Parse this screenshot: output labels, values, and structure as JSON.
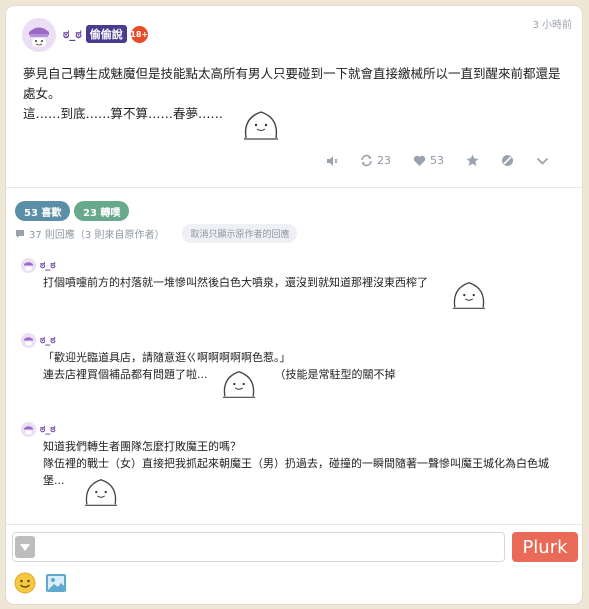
{
  "post": {
    "nickname": "ಠ_ಠ",
    "qualifier": "偷偷說",
    "age_badge": "18+",
    "time": "3 小時前",
    "line1": "夢見自己轉生成魅魔但是技能點太高所有男人只要碰到一下就會直接繳械所以一直到醒來前都還是處女。",
    "line2": "這……到底……算不算……春夢……"
  },
  "actions": {
    "mute_icon": "mute-icon",
    "replurk_count": "23",
    "like_count": "53",
    "favorite_icon": "star-icon",
    "block_icon": "block-icon",
    "more_icon": "chevron-down-icon"
  },
  "stats": {
    "likes_label": "53 喜歡",
    "replurks_label": "23 轉噗",
    "responses_label": "37 則回應（3 則來自原作者）",
    "author_filter_label": "取消只顯示原作者的回應"
  },
  "responses": [
    {
      "nickname": "ಠ_ಠ",
      "lines": [
        "打個噴嚏前方的村落就一堆慘叫然後白色大噴泉，還沒到就知道那裡沒東西榨了"
      ]
    },
    {
      "nickname": "ಠ_ಠ",
      "lines": [
        "「歡迎光臨道具店，請隨意逛ㄍ啊啊啊啊啊色惹。」",
        "連去店裡買個補品都有問題了啦...",
        "（技能是常駐型的關不掉"
      ]
    },
    {
      "nickname": "ಠ_ಠ",
      "lines": [
        "知道我們轉生者團隊怎麼打敗魔王的嗎？",
        "隊伍裡的戰士（女）直接把我抓起來朝魔王（男）扔過去，碰撞的一瞬間隨著一聲慘叫魔王城化為白色城堡..."
      ]
    }
  ],
  "composer": {
    "input_value": "",
    "submit_label": "Plurk"
  },
  "colors": {
    "accent_purple": "#6b3fa0",
    "like_pill": "#5b8fa8",
    "replurk_pill": "#67a98a",
    "plurk_button": "#e96a57",
    "badge_red": "#e84a2a"
  }
}
